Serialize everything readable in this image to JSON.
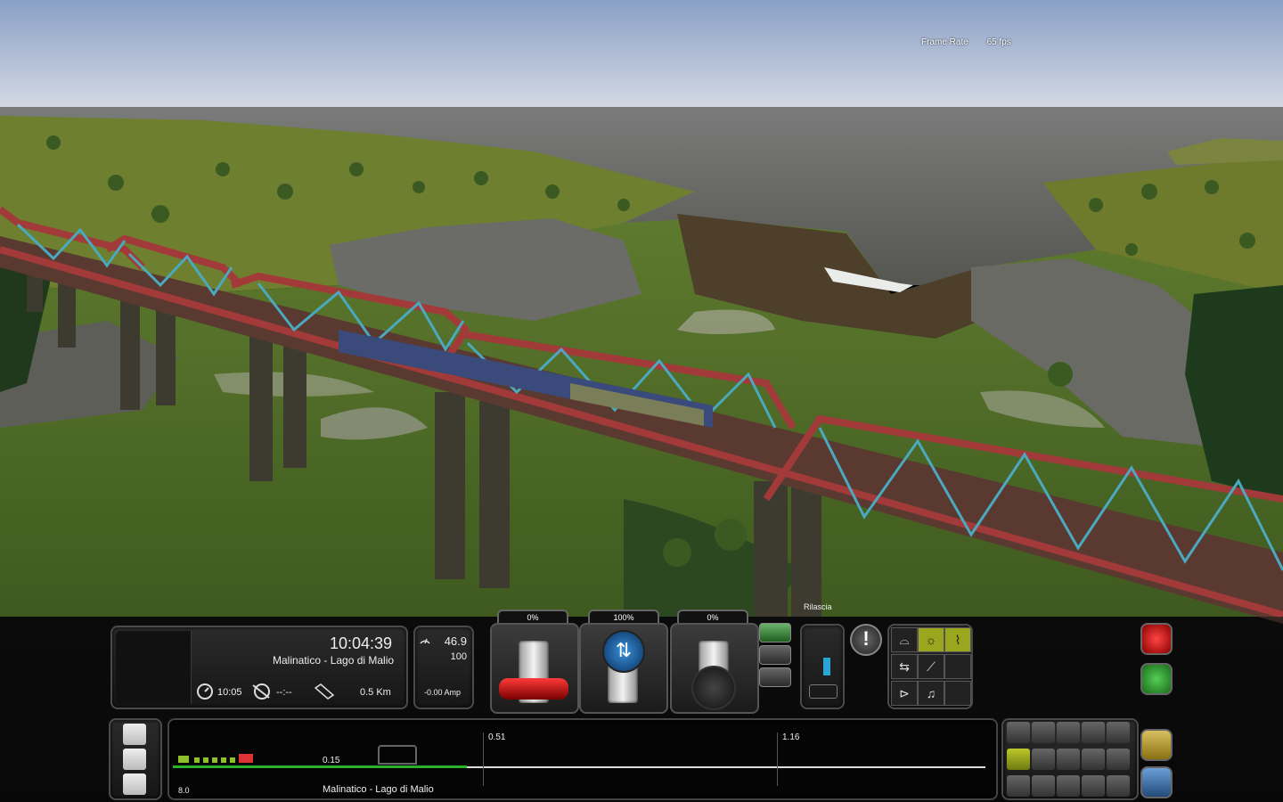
{
  "overlay": {
    "frame_rate_label": "Frame Rate",
    "frame_rate_value": "65 fps"
  },
  "info_panel": {
    "clock": "10:04:39",
    "route": "Malinatico - Lago di Malio",
    "arrival_time": "10:05",
    "delay": "--:--",
    "distance": "0.5 Km"
  },
  "speed_panel": {
    "speed": "46.9",
    "limit": "100",
    "amps": "-0.00 Amp"
  },
  "levers": [
    {
      "name": "throttle",
      "percent": "0%",
      "value": 0
    },
    {
      "name": "reverser",
      "percent": "100%",
      "value": 1.0
    },
    {
      "name": "train-brake",
      "percent": "0%",
      "value": 0
    }
  ],
  "brake_panel": {
    "label": "Rilascia"
  },
  "timeline": {
    "start_value": "8.0",
    "current_distance": "0.15",
    "markers": [
      "0.51",
      "1.16"
    ],
    "station": "Malinatico - Lago di Malio"
  },
  "colors": {
    "sky_top": "#8aa0c6",
    "sky_bottom": "#d9dde6",
    "bridge_red": "#a33a3a",
    "bridge_blue": "#4aa9bf",
    "grass": "#4e6e2a",
    "water": "#5f5f5c",
    "progress_green": "#2bb22b",
    "hud_accent": "#9aa61d"
  },
  "icons": {
    "camera_buttons": [
      "cab-camera-icon",
      "train-camera-icon",
      "freecam-icon"
    ],
    "function_grid": [
      "wiper-icon",
      "headlight-icon",
      "pantograph-icon",
      "coupler-icon",
      "sander-icon",
      "horn-icon",
      "bell-icon"
    ],
    "toolbar": [
      "save-icon",
      "task-icon",
      "switch-icon"
    ]
  }
}
